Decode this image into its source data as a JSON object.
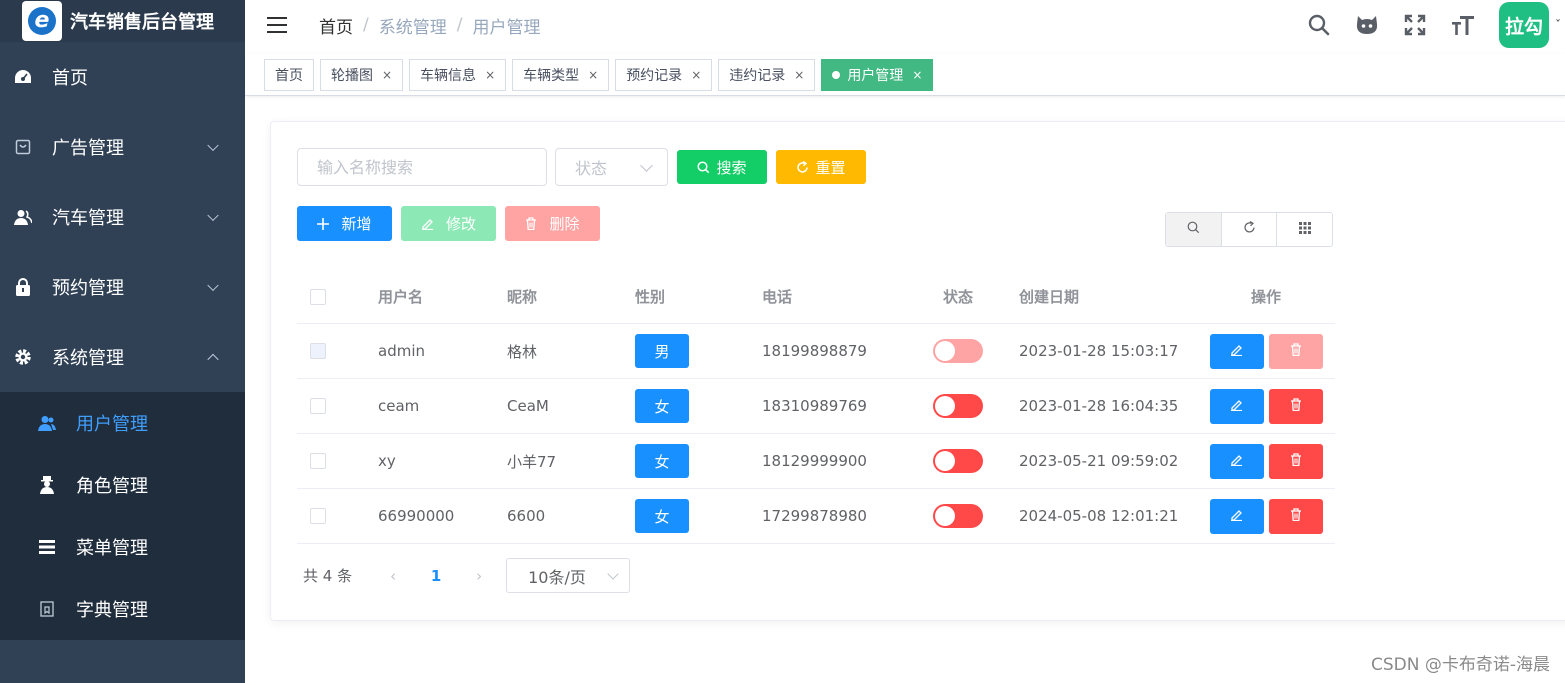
{
  "app": {
    "title": "汽车销售后台管理",
    "logo_letter": "e"
  },
  "sidebar": {
    "items": [
      {
        "label": "首页",
        "icon": "dashboard-icon"
      },
      {
        "label": "广告管理",
        "icon": "ad-icon"
      },
      {
        "label": "汽车管理",
        "icon": "user-icon"
      },
      {
        "label": "预约管理",
        "icon": "lock-icon"
      },
      {
        "label": "系统管理",
        "icon": "gear-icon"
      }
    ],
    "submenu": [
      {
        "label": "用户管理",
        "icon": "users-icon"
      },
      {
        "label": "角色管理",
        "icon": "role-icon"
      },
      {
        "label": "菜单管理",
        "icon": "list-icon"
      },
      {
        "label": "字典管理",
        "icon": "dict-icon"
      }
    ]
  },
  "breadcrumb": [
    "首页",
    "系统管理",
    "用户管理"
  ],
  "header": {
    "avatar_text": "拉勾"
  },
  "tags": [
    {
      "label": "首页"
    },
    {
      "label": "轮播图"
    },
    {
      "label": "车辆信息"
    },
    {
      "label": "车辆类型"
    },
    {
      "label": "预约记录"
    },
    {
      "label": "违约记录"
    },
    {
      "label": "用户管理"
    }
  ],
  "search": {
    "placeholder": "输入名称搜索",
    "status_placeholder": "状态",
    "search_label": "搜索",
    "reset_label": "重置"
  },
  "actions": {
    "add_label": "新增",
    "edit_label": "修改",
    "delete_label": "删除"
  },
  "table": {
    "headers": [
      "用户名",
      "昵称",
      "性别",
      "电话",
      "状态",
      "创建日期",
      "操作"
    ],
    "rows": [
      {
        "username": "admin",
        "nickname": "格林",
        "sex": "男",
        "phone": "18199898879",
        "created": "2023-01-28 15:03:17"
      },
      {
        "username": "ceam",
        "nickname": "CeaM",
        "sex": "女",
        "phone": "18310989769",
        "created": "2023-01-28 16:04:35"
      },
      {
        "username": "xy",
        "nickname": "小羊77",
        "sex": "女",
        "phone": "18129999900",
        "created": "2023-05-21 09:59:02"
      },
      {
        "username": "66990000",
        "nickname": "6600",
        "sex": "女",
        "phone": "17299878980",
        "created": "2024-05-08 12:01:21"
      }
    ]
  },
  "pagination": {
    "total_text": "共 4 条",
    "current_page": "1",
    "page_size": "10条/页"
  },
  "watermark": "CSDN @卡布奇诺-海晨",
  "colors": {
    "sidebar": "#304156",
    "primary": "#1890ff",
    "success": "#13ce66",
    "warning": "#ffba00",
    "danger": "#ff4949",
    "tag_active": "#42b983"
  }
}
